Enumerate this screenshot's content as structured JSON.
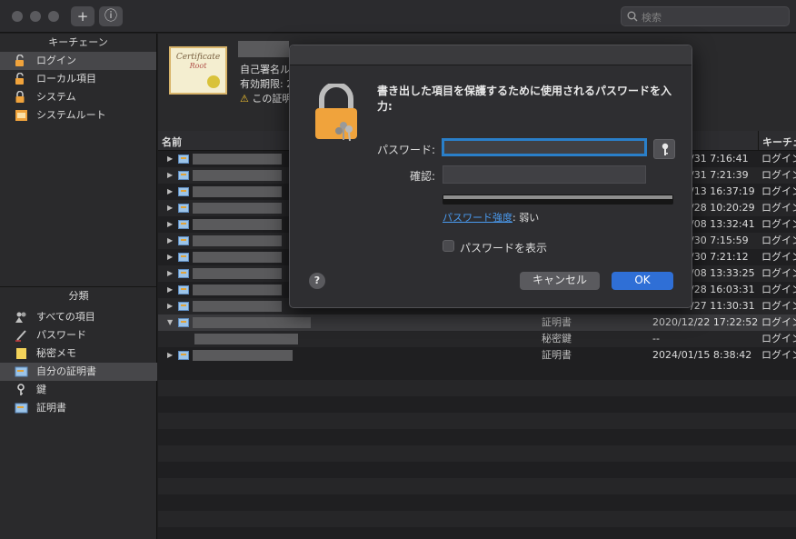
{
  "toolbar": {
    "add_label": "+",
    "info_label": "ⓘ",
    "search_placeholder": "検索"
  },
  "sidebar": {
    "keychain_header": "キーチェーン",
    "keychains": [
      {
        "label": "ログイン",
        "icon": "lock-open-icon",
        "selected": true
      },
      {
        "label": "ローカル項目",
        "icon": "lock-open-icon"
      },
      {
        "label": "システム",
        "icon": "lock-icon"
      },
      {
        "label": "システムルート",
        "icon": "cabinet-icon"
      }
    ],
    "category_header": "分類",
    "categories": [
      {
        "label": "すべての項目",
        "icon": "people-icon"
      },
      {
        "label": "パスワード",
        "icon": "pen-icon"
      },
      {
        "label": "秘密メモ",
        "icon": "note-icon"
      },
      {
        "label": "自分の証明書",
        "icon": "certificate-icon",
        "selected": true
      },
      {
        "label": "鍵",
        "icon": "key-icon"
      },
      {
        "label": "証明書",
        "icon": "certificate-icon"
      }
    ]
  },
  "detail": {
    "cert_art_line1": "Certificate",
    "cert_art_line2": "Root",
    "line1": "自己署名ルー",
    "line2": "有効期限: 2",
    "line3": "この証明"
  },
  "columns": {
    "name": "名前",
    "keychain": "キーチェ"
  },
  "rows": [
    {
      "date": "/31 7:16:41",
      "keychain": "ログイン"
    },
    {
      "date": "/31 7:21:39",
      "keychain": "ログイン"
    },
    {
      "date": "/13 16:37:19",
      "keychain": "ログイン"
    },
    {
      "date": "/28 10:20:29",
      "keychain": "ログイン"
    },
    {
      "date": "/08 13:32:41",
      "keychain": "ログイン"
    },
    {
      "date": "/30 7:15:59",
      "keychain": "ログイン"
    },
    {
      "date": "/30 7:21:12",
      "keychain": "ログイン"
    },
    {
      "date": "/08 13:33:25",
      "keychain": "ログイン"
    },
    {
      "date": "/28 16:03:31",
      "keychain": "ログイン"
    },
    {
      "date": "/27 11:30:31",
      "keychain": "ログイン"
    },
    {
      "kind": "証明書",
      "date": "2020/12/22 17:22:52",
      "keychain": "ログイン"
    },
    {
      "kind": "秘密鍵",
      "date": "--",
      "keychain": "ログイン"
    },
    {
      "kind": "証明書",
      "date": "2024/01/15 8:38:42",
      "keychain": "ログイン"
    }
  ],
  "dialog": {
    "message": "書き出した項目を保護するために使用されるパスワードを入力:",
    "password_label": "パスワード:",
    "password_value": "",
    "verify_label": "確認:",
    "verify_value": "",
    "strength_link": "パスワード強度",
    "strength_value": "弱い",
    "strength_level": 0,
    "show_password_label": "パスワードを表示",
    "show_password_checked": false,
    "help_label": "?",
    "cancel_label": "キャンセル",
    "ok_label": "OK"
  },
  "colors": {
    "accent": "#2f6fd6",
    "field_focus": "#2a7fc9",
    "lock_gold": "#f0a33c"
  }
}
